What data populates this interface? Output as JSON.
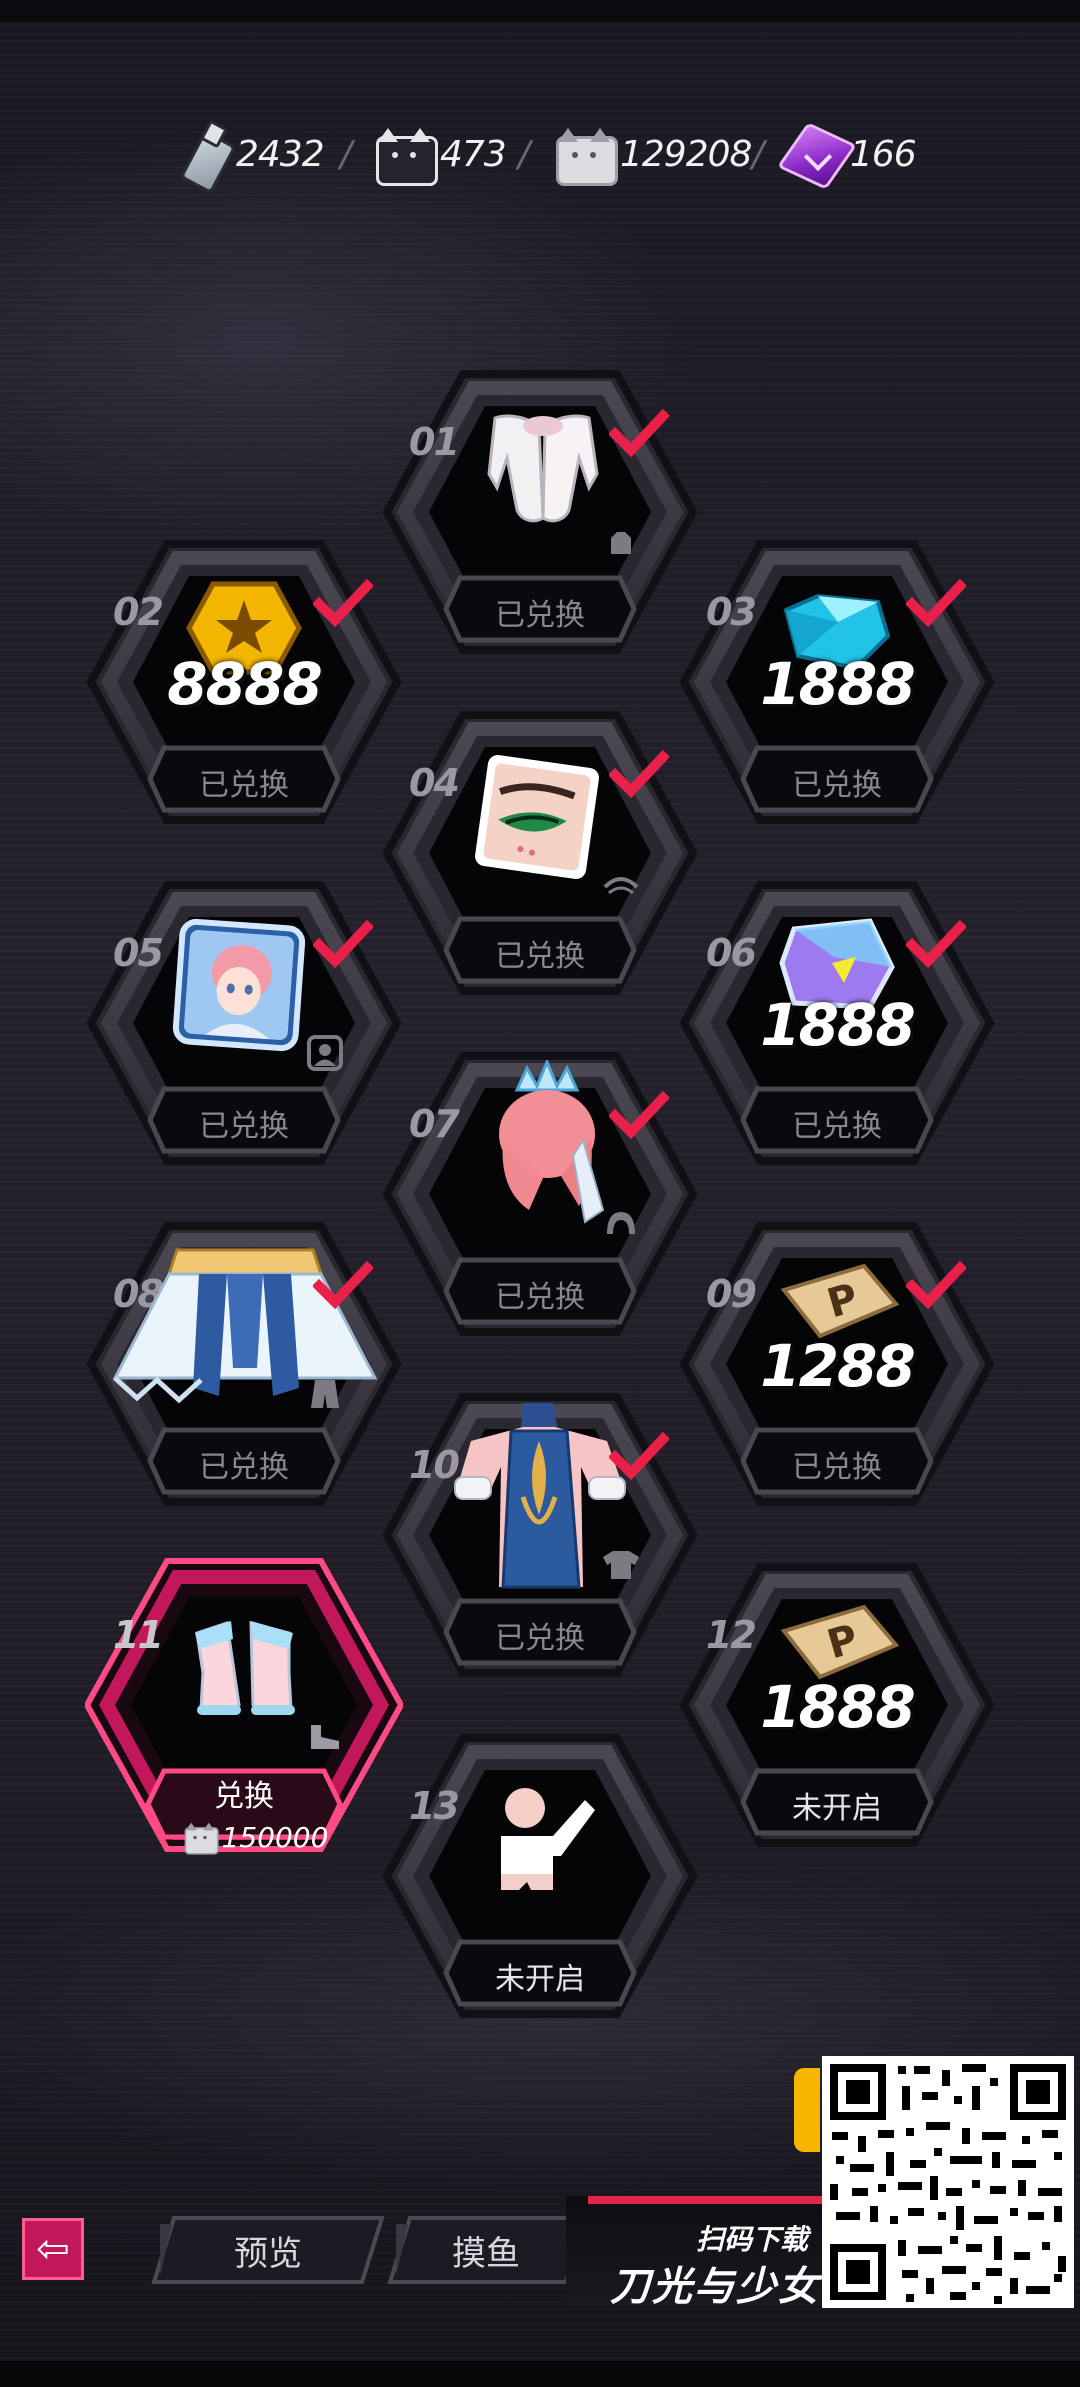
{
  "currency": [
    {
      "icon": "bottle-icon",
      "value": "2432"
    },
    {
      "icon": "black-cat-token-icon",
      "value": "473"
    },
    {
      "icon": "white-cat-token-icon",
      "value": "129208"
    },
    {
      "icon": "purple-cube-icon",
      "value": "166"
    }
  ],
  "separator": "/",
  "slots": [
    {
      "index": "01",
      "status": "已兑换",
      "reward": "white-gloves",
      "amount": "",
      "claimed": true
    },
    {
      "index": "02",
      "status": "已兑换",
      "reward": "gold-coin",
      "amount": "8888",
      "claimed": true
    },
    {
      "index": "03",
      "status": "已兑换",
      "reward": "blue-diamond",
      "amount": "1888",
      "claimed": true
    },
    {
      "index": "04",
      "status": "已兑换",
      "reward": "eye-makeup",
      "amount": "",
      "claimed": true
    },
    {
      "index": "05",
      "status": "已兑换",
      "reward": "avatar-frame",
      "amount": "",
      "claimed": true
    },
    {
      "index": "06",
      "status": "已兑换",
      "reward": "crystal-ticket",
      "amount": "1888",
      "claimed": true
    },
    {
      "index": "07",
      "status": "已兑换",
      "reward": "pink-hair",
      "amount": "",
      "claimed": true
    },
    {
      "index": "08",
      "status": "已兑换",
      "reward": "blue-skirt",
      "amount": "",
      "claimed": true
    },
    {
      "index": "09",
      "status": "已兑换",
      "reward": "p-ticket",
      "amount": "1288",
      "claimed": true
    },
    {
      "index": "10",
      "status": "已兑换",
      "reward": "blue-dress",
      "amount": "",
      "claimed": true
    },
    {
      "index": "11",
      "status": "兑换",
      "reward": "shoes",
      "amount": "",
      "claimed": false,
      "cost": "150000"
    },
    {
      "index": "12",
      "status": "未开启",
      "reward": "p-ticket",
      "amount": "1888",
      "claimed": false
    },
    {
      "index": "13",
      "status": "未开启",
      "reward": "pose-action",
      "amount": "",
      "claimed": false
    }
  ],
  "nav": {
    "back_icon": "back-arrow-icon",
    "preview_label": "预览",
    "fish_label": "摸鱼"
  },
  "promo": {
    "scan_text": "扫码下载",
    "game_name": "刀光与少女"
  },
  "colors": {
    "accent": "#e32548",
    "active_frame": "#d81b60",
    "check": "#e8204a",
    "background": "#1f1c26"
  }
}
